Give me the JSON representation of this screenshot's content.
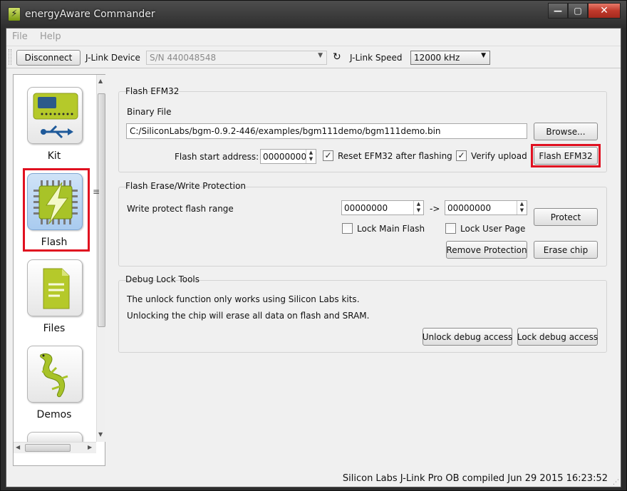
{
  "window": {
    "title": "energyAware Commander"
  },
  "menu": {
    "items": [
      "File",
      "Help"
    ]
  },
  "toolbar": {
    "disconnect_label": "Disconnect",
    "jlink_device_label": "J-Link Device",
    "device_value": "S/N 440048548",
    "jlink_speed_label": "J-Link Speed",
    "speed_value": "12000 kHz"
  },
  "sidebar": {
    "items": [
      {
        "label": "Kit"
      },
      {
        "label": "Flash"
      },
      {
        "label": "Files"
      },
      {
        "label": "Demos"
      }
    ]
  },
  "flash_group": {
    "title": "Flash EFM32",
    "binary_file_label": "Binary File",
    "file_path": "C:/SiliconLabs/bgm-0.9.2-446/examples/bgm111demo/bgm111demo.bin",
    "browse_label": "Browse...",
    "start_address_label": "Flash start address:",
    "start_address_value": "00000000",
    "reset_label": "Reset EFM32 after flashing",
    "reset_checked": true,
    "verify_label": "Verify upload",
    "verify_checked": true,
    "flash_button_label": "Flash EFM32"
  },
  "protection_group": {
    "title": "Flash Erase/Write Protection",
    "range_label": "Write protect flash range",
    "range_start": "00000000",
    "range_arrow": "->",
    "range_end": "00000000",
    "protect_label": "Protect",
    "lock_main_label": "Lock Main Flash",
    "lock_user_label": "Lock User Page",
    "remove_protection_label": "Remove Protection",
    "erase_chip_label": "Erase chip"
  },
  "debug_group": {
    "title": "Debug Lock Tools",
    "line1": "The unlock function only works using Silicon Labs kits.",
    "line2": "Unlocking the chip will erase all data on flash and SRAM.",
    "unlock_label": "Unlock debug access",
    "lock_label": "Lock debug access"
  },
  "status": {
    "text": "Silicon Labs J-Link Pro OB compiled Jun 29 2015 16:23:52"
  },
  "colors": {
    "highlight": "#e01020",
    "active_tile": "#a9cbef",
    "icon_green": "#b5c92a"
  }
}
